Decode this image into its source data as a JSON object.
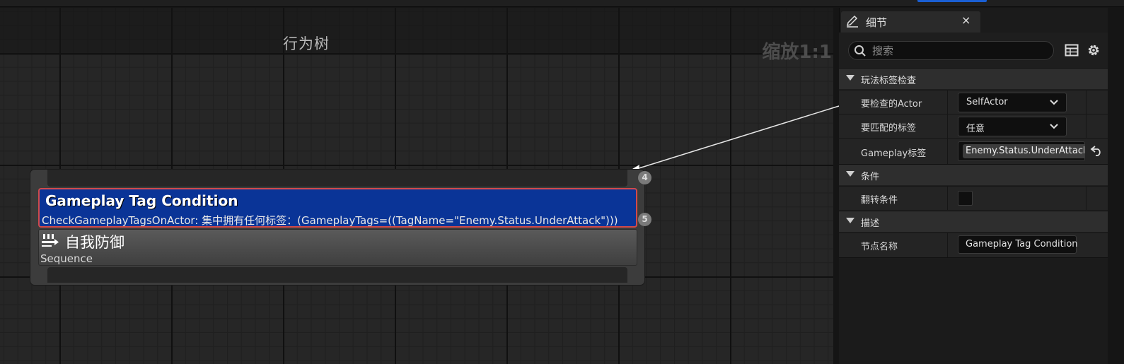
{
  "graph": {
    "title": "行为树",
    "zoom": "缩放1:1"
  },
  "node": {
    "decorator_title": "Gameplay Tag Condition",
    "decorator_description": "CheckGameplayTagsOnActor: 集中拥有任何标签：(GameplayTags=((TagName=\"Enemy.Status.UnderAttack\")))",
    "composite_title": "自我防御",
    "composite_type": "Sequence",
    "decorator_index": "5",
    "composite_index": "4",
    "decorator_border_color": "#d24a4a",
    "decorator_fill_color": "#0a3497"
  },
  "details": {
    "tab_label": "细节",
    "close_glyph": "×",
    "search_placeholder": "搜索",
    "categories": [
      {
        "label": "玩法标签检查",
        "properties": [
          {
            "label": "要检查的Actor",
            "value": "SelfActor"
          },
          {
            "label": "要匹配的标签",
            "value": "任意"
          },
          {
            "label": "Gameplay标签",
            "value": "Enemy.Status.UnderAttack"
          }
        ]
      },
      {
        "label": "条件",
        "properties": [
          {
            "label": "翻转条件",
            "checked": false
          }
        ]
      },
      {
        "label": "描述",
        "properties": [
          {
            "label": "节点名称",
            "value": "Gameplay Tag Condition"
          }
        ]
      }
    ]
  },
  "accent_color": "#1a5fd4"
}
